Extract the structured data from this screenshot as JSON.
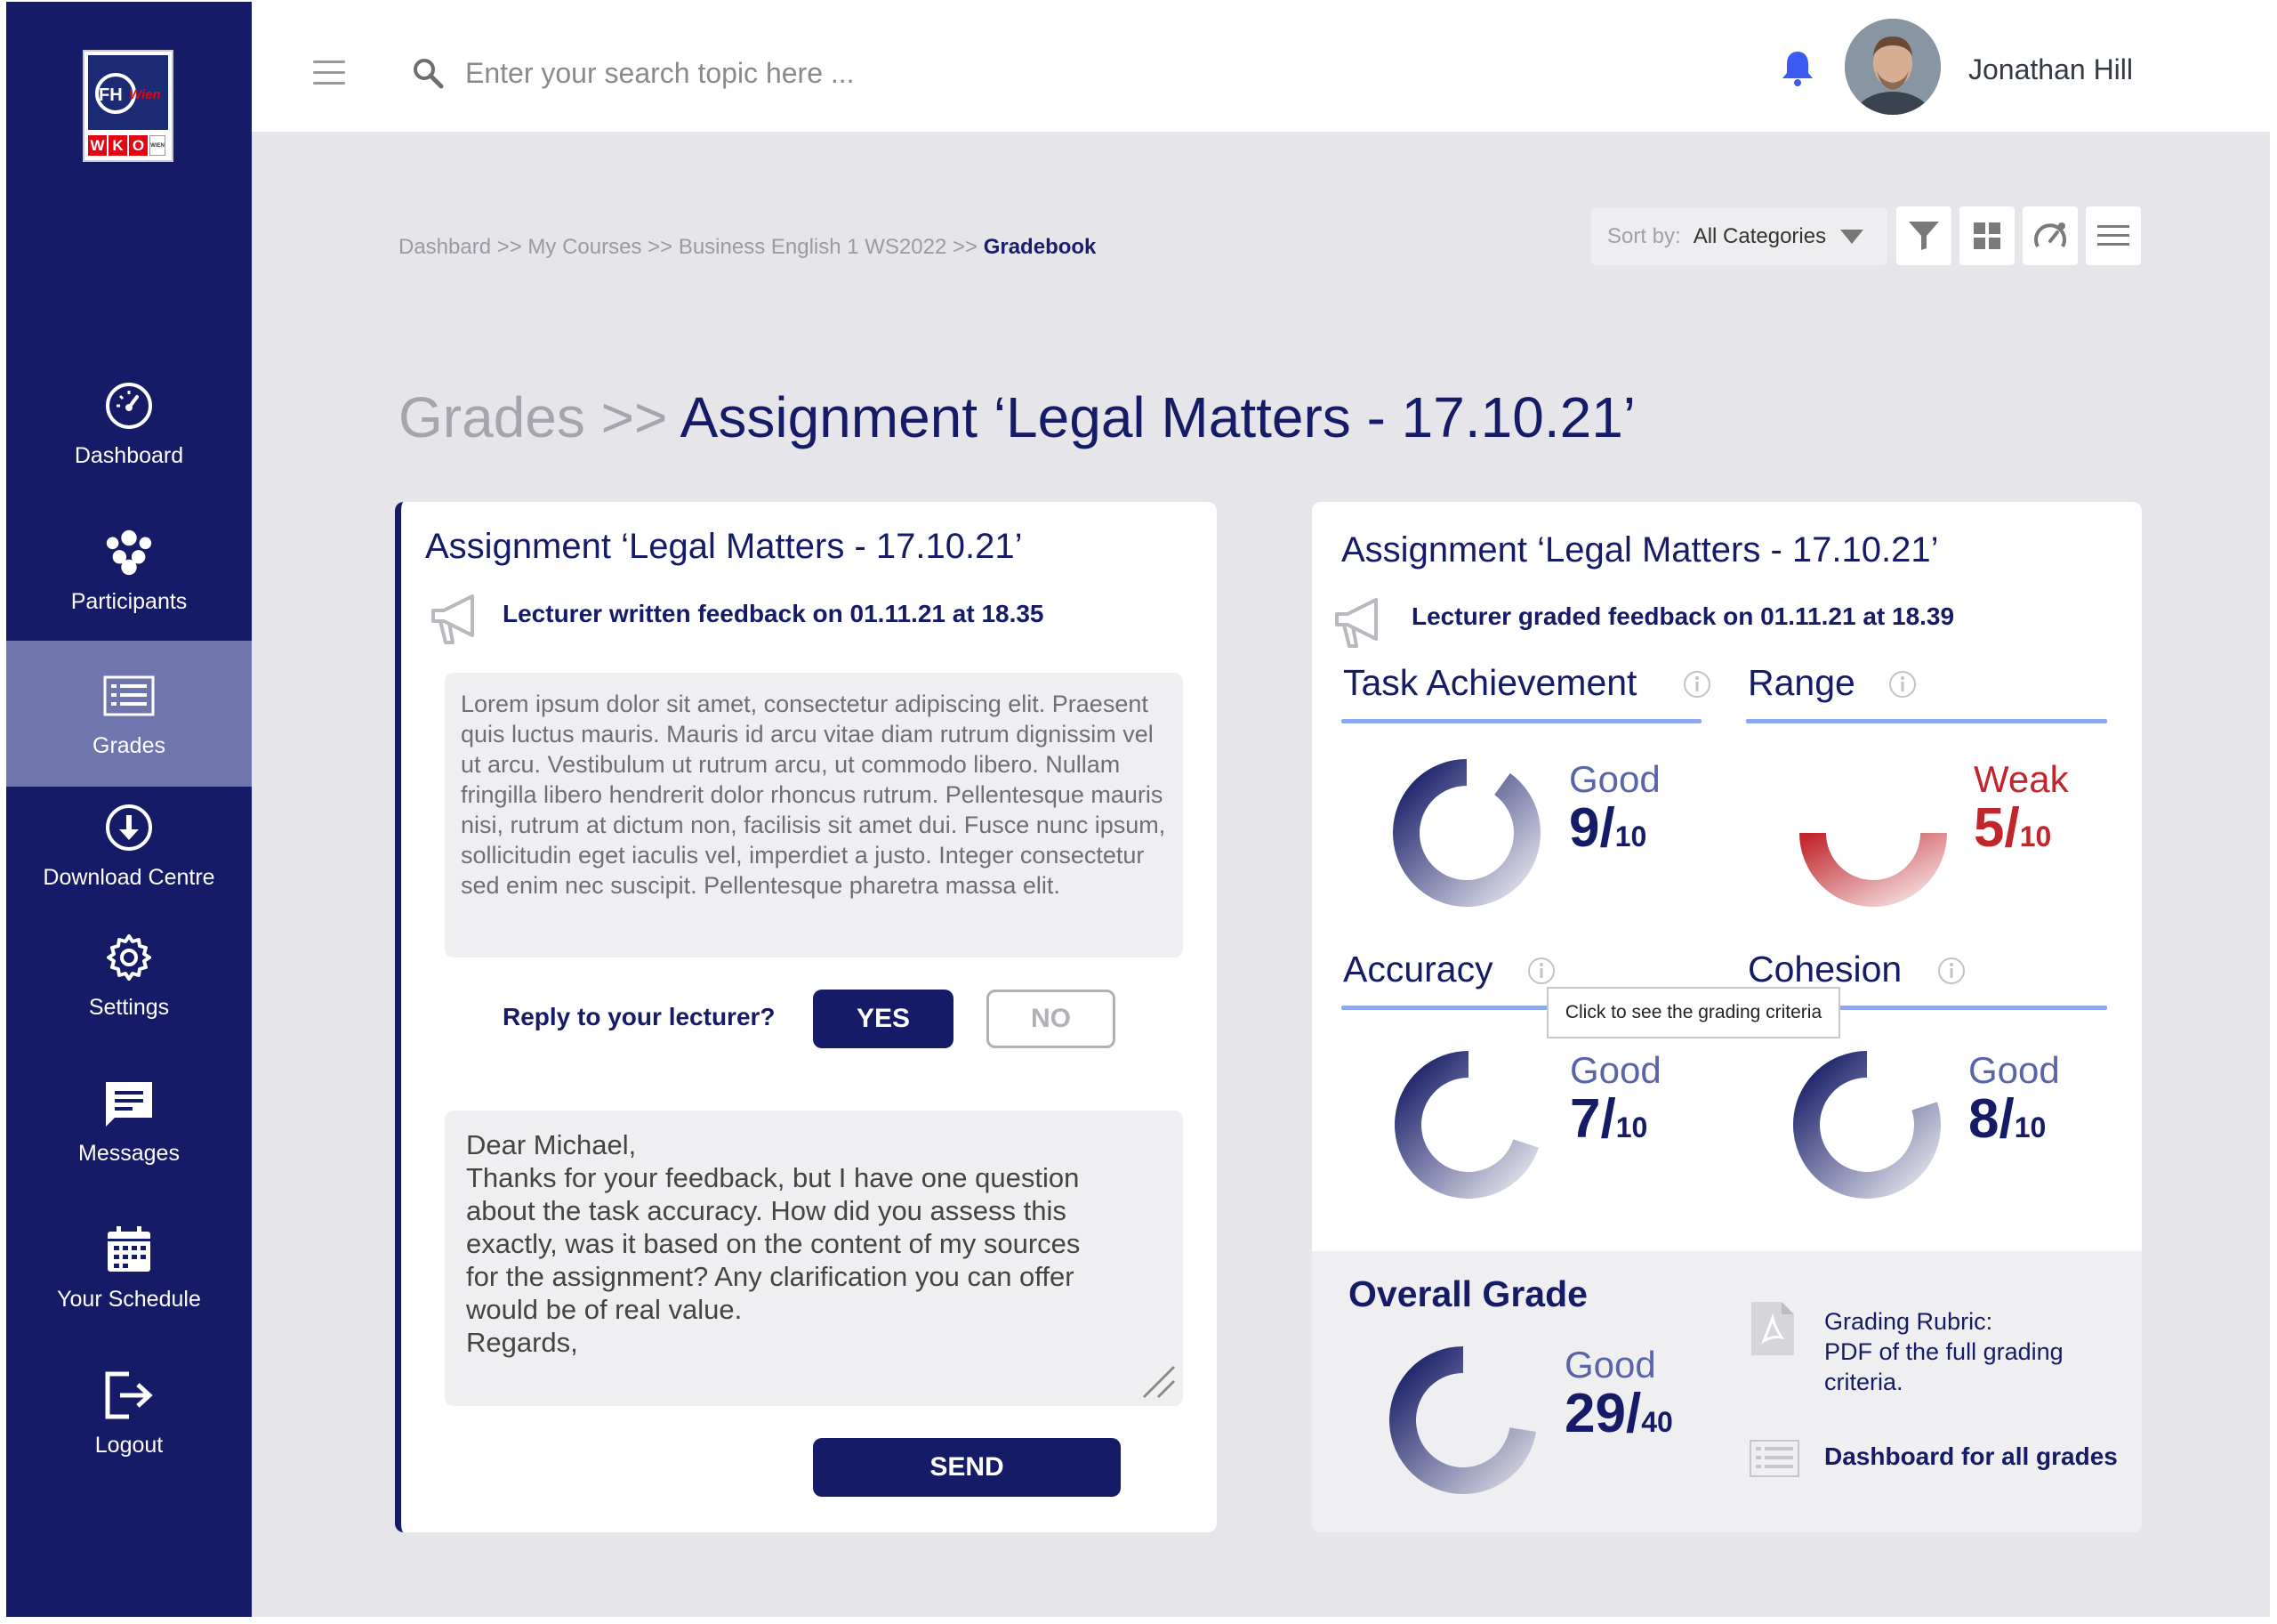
{
  "sidebar": {
    "logo": {
      "top_left": "FH",
      "top_right": "Wien",
      "letters": [
        "W",
        "K",
        "O"
      ],
      "small": "WIEN"
    },
    "items": [
      {
        "label": "Dashboard",
        "icon": "speedometer-icon",
        "active": false
      },
      {
        "label": "Participants",
        "icon": "group-icon",
        "active": false
      },
      {
        "label": "Grades",
        "icon": "gradebook-icon",
        "active": true
      },
      {
        "label": "Download Centre",
        "icon": "download-icon",
        "active": false
      },
      {
        "label": "Settings",
        "icon": "gear-icon",
        "active": false
      },
      {
        "label": "Messages",
        "icon": "message-icon",
        "active": false
      },
      {
        "label": "Your Schedule",
        "icon": "calendar-icon",
        "active": false
      },
      {
        "label": "Logout",
        "icon": "logout-icon",
        "active": false
      }
    ]
  },
  "header": {
    "search_placeholder": "Enter your search topic here ...",
    "user_name": "Jonathan Hill"
  },
  "breadcrumb": {
    "path": "Dashbard >> My Courses >> Business English 1 WS2022 >> ",
    "current": "Gradebook"
  },
  "toolbar": {
    "sort_label": "Sort by:",
    "sort_value": "All Categories"
  },
  "page_title": {
    "prefix": "Grades >> ",
    "main": "Assignment ‘Legal Matters - 17.10.21’"
  },
  "left_card": {
    "title": "Assignment ‘Legal Matters - 17.10.21’",
    "feedback_meta": "Lecturer written feedback on 01.11.21 at 18.35",
    "feedback_text": "Lorem ipsum dolor sit amet, consectetur adipiscing elit. Praesent quis luctus mauris. Mauris id arcu vitae diam rutrum dignissim vel ut arcu. Vestibulum ut rutrum arcu, ut commodo libero. Nullam fringilla libero hendrerit dolor rhoncus rutrum. Pellentesque mauris nisi, rutrum at dictum non, facilisis sit amet dui. Fusce nunc ipsum, sollicitudin eget iaculis vel, imperdiet a justo. Integer consectetur sed enim nec suscipit. Pellentesque pharetra massa elit.",
    "reply_prompt": "Reply to your lecturer?",
    "yes_label": "YES",
    "no_label": "NO",
    "reply_lines": [
      "Dear Michael,",
      "Thanks for your feedback, but I have one question",
      "about the task accuracy. How did you assess this",
      "exactly, was it based on the content of my sources",
      "for the assignment? Any clarification you can offer",
      "would be of real value.",
      "Regards,"
    ],
    "send_label": "SEND"
  },
  "right_card": {
    "title": "Assignment ‘Legal Matters - 17.10.21’",
    "feedback_meta": "Lecturer graded feedback on 01.11.21 at 18.39",
    "criteria": [
      {
        "name": "Task Achievement",
        "word": "Good",
        "score": "9/",
        "max": "10",
        "value": 9,
        "out_of": 10,
        "color": "#151b66",
        "word_color": "#5a64a8"
      },
      {
        "name": "Range",
        "word": "Weak",
        "score": "5/",
        "max": "10",
        "value": 5,
        "out_of": 10,
        "color": "#c0262c",
        "word_color": "#c0262c"
      },
      {
        "name": "Accuracy",
        "word": "Good",
        "score": "7/",
        "max": "10",
        "value": 7,
        "out_of": 10,
        "color": "#151b66",
        "word_color": "#5a64a8"
      },
      {
        "name": "Cohesion",
        "word": "Good",
        "score": "8/",
        "max": "10",
        "value": 8,
        "out_of": 10,
        "color": "#151b66",
        "word_color": "#5a64a8"
      }
    ],
    "tooltip": "Click to see the grading criteria",
    "overall": {
      "title": "Overall Grade",
      "word": "Good",
      "score": "29/",
      "max": "40",
      "value": 29,
      "out_of": 40
    },
    "rubric_lines": [
      "Grading Rubric:",
      "PDF of the full grading",
      "criteria."
    ],
    "dashboard_link": "Dashboard for all grades"
  },
  "colors": {
    "navy": "#151b66",
    "active_nav": "#6f76ad",
    "weak_red": "#c0262c",
    "underline_blue": "#8fa7f0",
    "bell_blue": "#3b5bf0"
  }
}
